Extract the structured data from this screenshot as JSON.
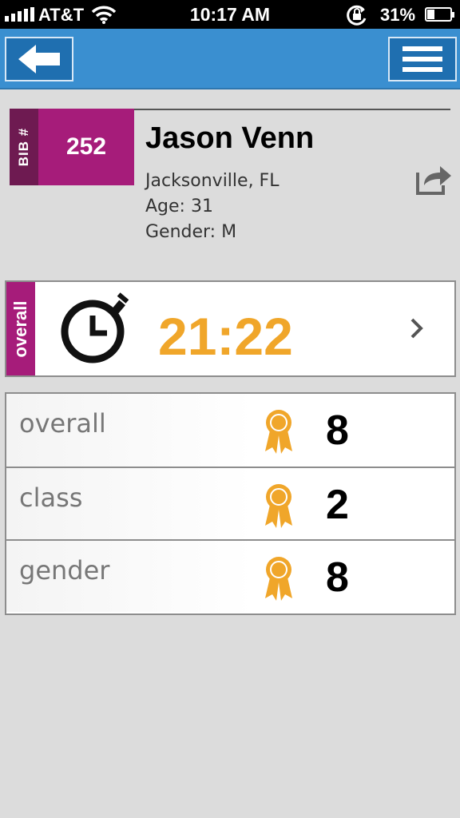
{
  "status_bar": {
    "carrier": "AT&T",
    "time": "10:17 AM",
    "battery_percent": "31%",
    "battery_level": 0.31,
    "icons": [
      "signal-icon",
      "wifi-icon",
      "rotation-lock-icon",
      "battery-charging-icon"
    ]
  },
  "nav": {
    "back_icon": "arrow-left-icon",
    "menu_icon": "hamburger-menu-icon",
    "accent_color": "#3a8fd0"
  },
  "athlete": {
    "bib_label": "BIB #",
    "bib_number": "252",
    "name": "Jason Venn",
    "location": "Jacksonville, FL",
    "age": "Age: 31",
    "gender": "Gender: M",
    "share_icon": "share-icon",
    "bib_color": "#a61c7a"
  },
  "overall_time": {
    "tag": "overall",
    "value": "21:22",
    "icon": "stopwatch-icon",
    "chevron_icon": "chevron-right-icon",
    "time_color": "#f0a62a"
  },
  "placings": [
    {
      "label": "overall",
      "value": "8",
      "icon": "award-ribbon-icon"
    },
    {
      "label": "class",
      "value": "2",
      "icon": "award-ribbon-icon"
    },
    {
      "label": "gender",
      "value": "8",
      "icon": "award-ribbon-icon"
    }
  ]
}
